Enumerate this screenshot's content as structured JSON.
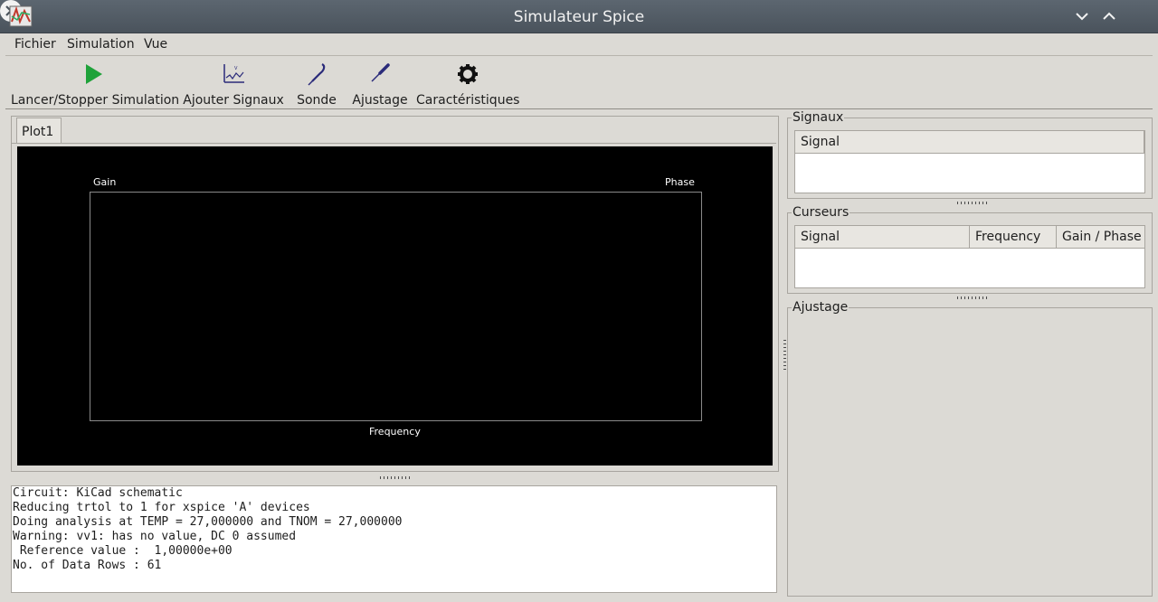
{
  "window": {
    "title": "Simulateur Spice"
  },
  "menu": [
    "Fichier",
    "Simulation",
    "Vue"
  ],
  "toolbar": {
    "run": "Lancer/Stopper Simulation",
    "add_signals": "Ajouter Signaux",
    "probe": "Sonde",
    "tune": "Ajustage",
    "settings": "Caractéristiques"
  },
  "tabs": [
    "Plot1"
  ],
  "plot": {
    "left_axis": "Gain",
    "right_axis": "Phase",
    "x_axis": "Frequency"
  },
  "console": [
    "Circuit: KiCad schematic",
    "Reducing trtol to 1 for xspice 'A' devices",
    "Doing analysis at TEMP = 27,000000 and TNOM = 27,000000",
    "Warning: vv1: has no value, DC 0 assumed",
    " Reference value :  1,00000e+00",
    "No. of Data Rows : 61"
  ],
  "signals_panel": {
    "title": "Signaux",
    "columns": [
      "Signal"
    ]
  },
  "cursors_panel": {
    "title": "Curseurs",
    "columns": [
      "Signal",
      "Frequency",
      "Gain / Phase"
    ]
  },
  "tuning_panel": {
    "title": "Ajustage"
  },
  "colors": {
    "run_icon": "#1fa23a",
    "tool_icon": "#2b2b7a",
    "plot_bg": "#000000"
  }
}
